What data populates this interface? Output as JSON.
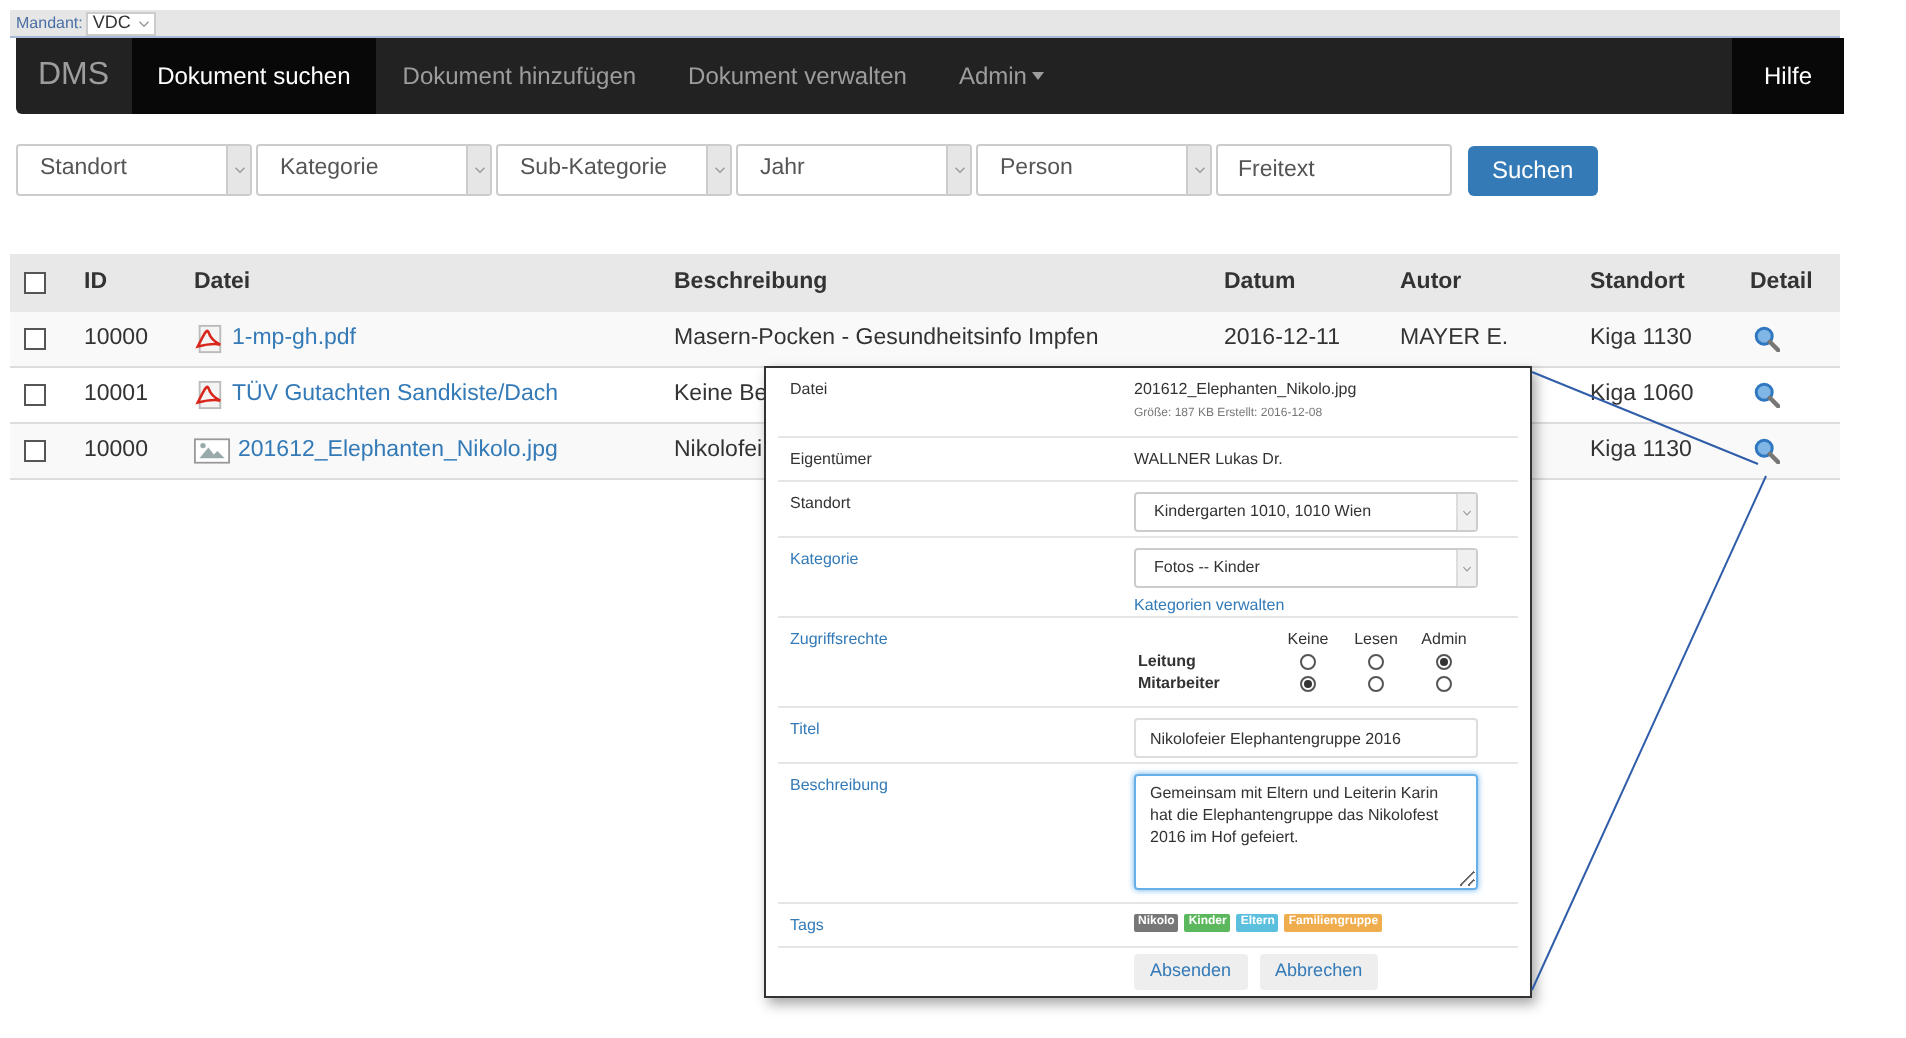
{
  "mandant": {
    "label": "Mandant:",
    "value": "VDC"
  },
  "navbar": {
    "brand": "DMS",
    "items": [
      {
        "label": "Dokument suchen",
        "selected": true,
        "dropdown": false
      },
      {
        "label": "Dokument hinzufügen",
        "selected": false,
        "dropdown": false
      },
      {
        "label": "Dokument verwalten",
        "selected": false,
        "dropdown": false
      },
      {
        "label": "Admin",
        "selected": false,
        "dropdown": true
      }
    ],
    "help": "Hilfe"
  },
  "filters": [
    {
      "kind": "select",
      "placeholder": "Standort"
    },
    {
      "kind": "select",
      "placeholder": "Kategorie"
    },
    {
      "kind": "select",
      "placeholder": "Sub-Kategorie"
    },
    {
      "kind": "select",
      "placeholder": "Jahr"
    },
    {
      "kind": "select",
      "placeholder": "Person"
    },
    {
      "kind": "input",
      "placeholder": "Freitext"
    }
  ],
  "search_button": "Suchen",
  "table": {
    "header_checked": false,
    "columns": [
      "ID",
      "Datei",
      "Beschreibung",
      "Datum",
      "Autor",
      "Standort",
      "Detail"
    ],
    "rows": [
      {
        "checked": false,
        "id": "10000",
        "kind": "pdf",
        "file": "1-mp-gh.pdf",
        "description": "Masern-Pocken - Gesundheitsinfo Impfen",
        "date": "2016-12-11",
        "author": "MAYER E.",
        "location": "Kiga 1130"
      },
      {
        "checked": false,
        "id": "10001",
        "kind": "pdf",
        "file": "TÜV Gutachten Sandkiste/Dach",
        "description": "Keine Be",
        "location": "Kiga 1060"
      },
      {
        "checked": false,
        "id": "10000",
        "kind": "image",
        "file": "201612_Elephanten_Nikolo.jpg",
        "description": "Nikolofei",
        "location": "Kiga 1130"
      }
    ]
  },
  "detail": {
    "fields": [
      {
        "kind": "file",
        "label": "Datei",
        "link": false,
        "value": "201612_Elephanten_Nikolo.jpg",
        "meta": "Größe: 187 KB Erstellt: 2016-12-08"
      },
      {
        "kind": "text",
        "label": "Eigentümer",
        "link": false,
        "value": "WALLNER Lukas Dr."
      },
      {
        "kind": "select",
        "label": "Standort",
        "link": false,
        "value": "Kindergarten 1010, 1010 Wien"
      },
      {
        "kind": "select",
        "label": "Kategorie",
        "link": true,
        "value": "Fotos -- Kinder",
        "action": "Kategorien verwalten"
      },
      {
        "kind": "rights",
        "label": "Zugriffsrechte",
        "link": true,
        "columns": [
          "Keine",
          "Lesen",
          "Admin"
        ],
        "rows": [
          {
            "label": "Leitung",
            "options": [
              {
                "selected": false
              },
              {
                "selected": false
              },
              {
                "selected": true
              }
            ]
          },
          {
            "label": "Mitarbeiter",
            "options": [
              {
                "selected": true
              },
              {
                "selected": false
              },
              {
                "selected": false
              }
            ]
          }
        ]
      },
      {
        "kind": "input",
        "label": "Titel",
        "link": true,
        "value": "Nikolofeier Elephantengruppe 2016"
      },
      {
        "kind": "textarea",
        "label": "Beschreibung",
        "link": true,
        "focused": true,
        "value": "Gemeinsam mit Eltern und Leiterin Karin hat die Elephantengruppe das Nikolofest 2016 im Hof gefeiert."
      },
      {
        "kind": "tags",
        "label": "Tags",
        "link": true,
        "tags": [
          {
            "label": "Nikolo",
            "color": "#777777"
          },
          {
            "label": "Kinder",
            "color": "#5cb85c"
          },
          {
            "label": "Eltern",
            "color": "#5bc0de"
          },
          {
            "label": "Familiengruppe",
            "color": "#f0ad4e"
          }
        ]
      }
    ],
    "buttons": [
      "Absenden",
      "Abbrechen"
    ]
  }
}
